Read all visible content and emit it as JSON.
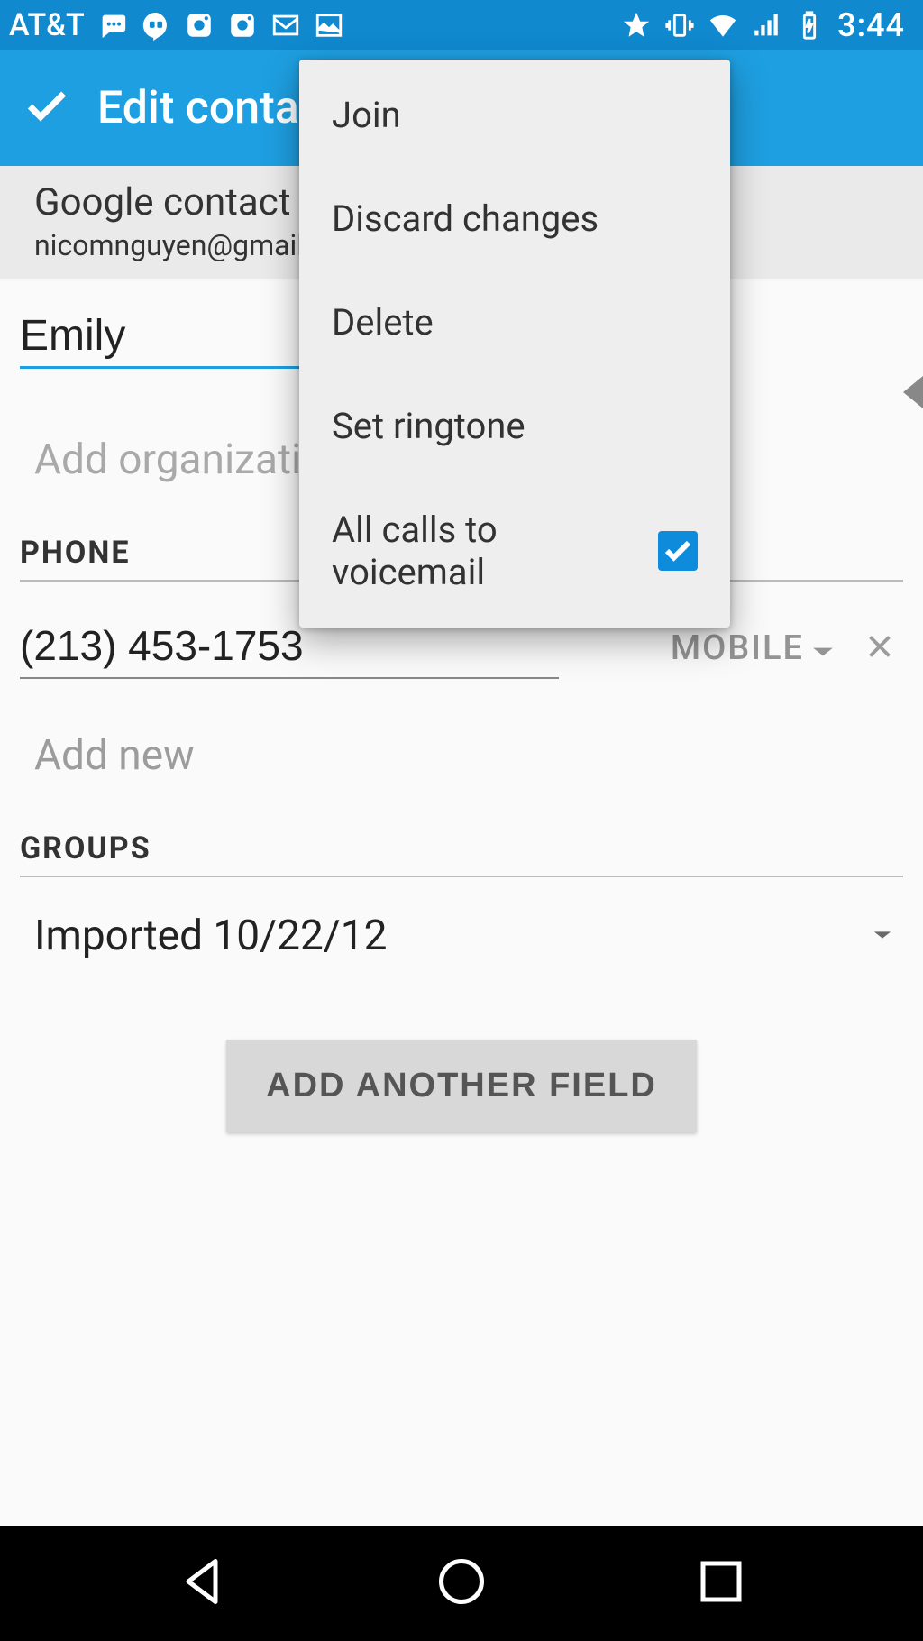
{
  "status": {
    "carrier": "AT&T",
    "time": "3:44"
  },
  "appbar": {
    "title": "Edit contact"
  },
  "account": {
    "type": "Google contact",
    "email": "nicomnguyen@gmail.com"
  },
  "name": {
    "value": "Emily"
  },
  "add_organization": "Add organization",
  "sections": {
    "phone_header": "PHONE",
    "groups_header": "GROUPS"
  },
  "phone": {
    "number": "(213) 453-1753",
    "type": "MOBILE",
    "add_new": "Add new"
  },
  "group": {
    "selected": "Imported 10/22/12"
  },
  "add_field_button": "ADD ANOTHER FIELD",
  "menu": {
    "items": [
      {
        "label": "Join"
      },
      {
        "label": "Discard changes"
      },
      {
        "label": "Delete"
      },
      {
        "label": "Set ringtone"
      },
      {
        "label": "All calls to voicemail",
        "checked": true
      }
    ]
  }
}
